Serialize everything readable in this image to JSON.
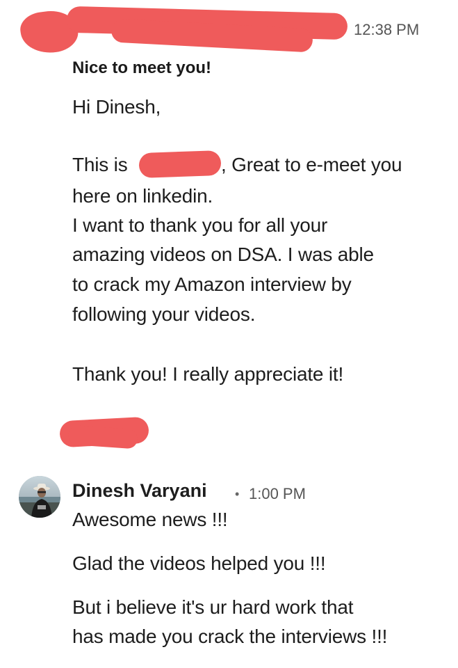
{
  "conversation": {
    "first_message": {
      "timestamp": "12:38 PM",
      "subject": "Nice to meet you!",
      "lines": [
        "Hi Dinesh,",
        "This is",
        ", Great to e-meet you",
        "here on linkedin.",
        "I want to thank you for all your",
        "amazing videos on DSA. I was able",
        "to crack my Amazon interview by",
        "following your videos.",
        "Thank you! I really appreciate it!"
      ]
    },
    "reply": {
      "sender_name": "Dinesh Varyani",
      "separator": "•",
      "timestamp": "1:00 PM",
      "lines": [
        "Awesome news !!!",
        "Glad the videos helped you !!!",
        "But i believe it's ur hard work that",
        "has made you crack the interviews !!!"
      ]
    }
  },
  "colors": {
    "redaction": "#ef5b5b",
    "text": "#1d1d1d",
    "muted": "#555555"
  },
  "icons": {
    "avatar": "profile-photo"
  }
}
